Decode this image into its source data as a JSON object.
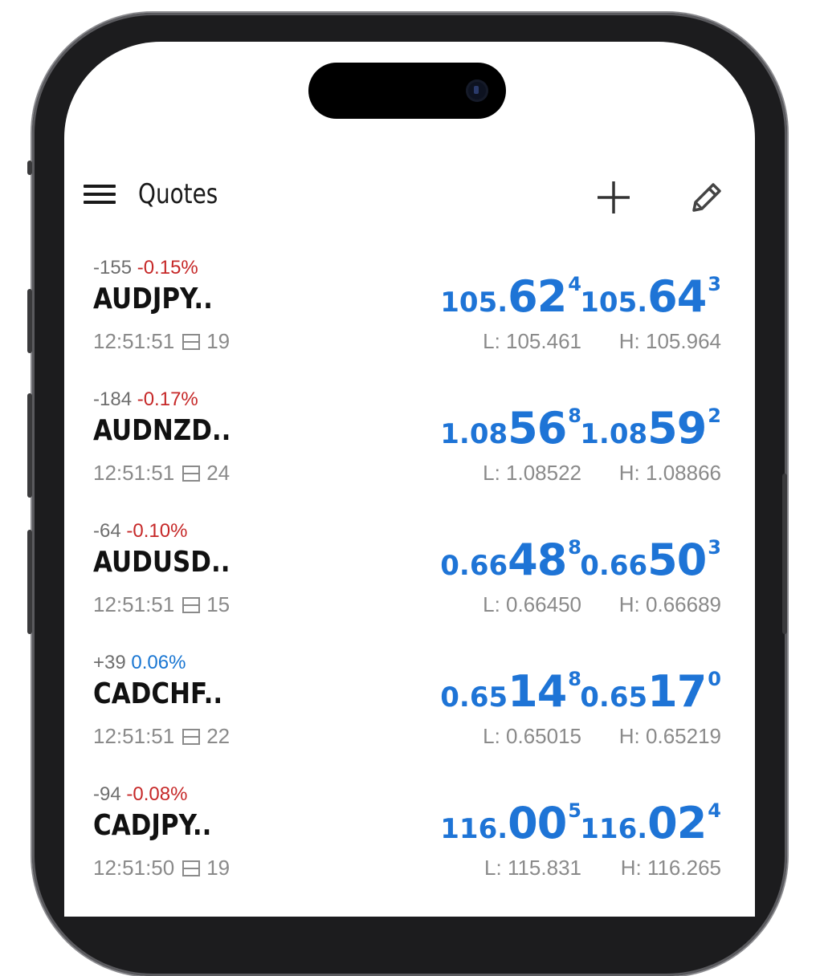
{
  "header": {
    "title": "Quotes",
    "menu_icon": "hamburger-menu-icon",
    "add_icon": "plus-icon",
    "edit_icon": "pencil-icon"
  },
  "colors": {
    "price_blue": "#1e74d6",
    "negative_red": "#c62828",
    "positive_blue": "#1976d2",
    "muted_gray": "#8a8a8a"
  },
  "quotes": [
    {
      "points": "-155",
      "percent": "-0.15%",
      "direction": "neg",
      "symbol": "AUDJPY..",
      "time": "12:51:51",
      "spread": "19",
      "bid": {
        "pre": "105.",
        "big": "62",
        "sup": "4"
      },
      "ask": {
        "pre": "105.",
        "big": "64",
        "sup": "3"
      },
      "low": "L: 105.461",
      "high": "H: 105.964"
    },
    {
      "points": "-184",
      "percent": "-0.17%",
      "direction": "neg",
      "symbol": "AUDNZD..",
      "time": "12:51:51",
      "spread": "24",
      "bid": {
        "pre": "1.08",
        "big": "56",
        "sup": "8"
      },
      "ask": {
        "pre": "1.08",
        "big": "59",
        "sup": "2"
      },
      "low": "L: 1.08522",
      "high": "H: 1.08866"
    },
    {
      "points": "-64",
      "percent": "-0.10%",
      "direction": "neg",
      "symbol": "AUDUSD..",
      "time": "12:51:51",
      "spread": "15",
      "bid": {
        "pre": "0.66",
        "big": "48",
        "sup": "8"
      },
      "ask": {
        "pre": "0.66",
        "big": "50",
        "sup": "3"
      },
      "low": "L: 0.66450",
      "high": "H: 0.66689"
    },
    {
      "points": "+39",
      "percent": "0.06%",
      "direction": "pos",
      "symbol": "CADCHF..",
      "time": "12:51:51",
      "spread": "22",
      "bid": {
        "pre": "0.65",
        "big": "14",
        "sup": "8"
      },
      "ask": {
        "pre": "0.65",
        "big": "17",
        "sup": "0"
      },
      "low": "L: 0.65015",
      "high": "H: 0.65219"
    },
    {
      "points": "-94",
      "percent": "-0.08%",
      "direction": "neg",
      "symbol": "CADJPY..",
      "time": "12:51:50",
      "spread": "19",
      "bid": {
        "pre": "116.",
        "big": "00",
        "sup": "5"
      },
      "ask": {
        "pre": "116.",
        "big": "02",
        "sup": "4"
      },
      "low": "L: 115.831",
      "high": "H: 116.265"
    }
  ]
}
